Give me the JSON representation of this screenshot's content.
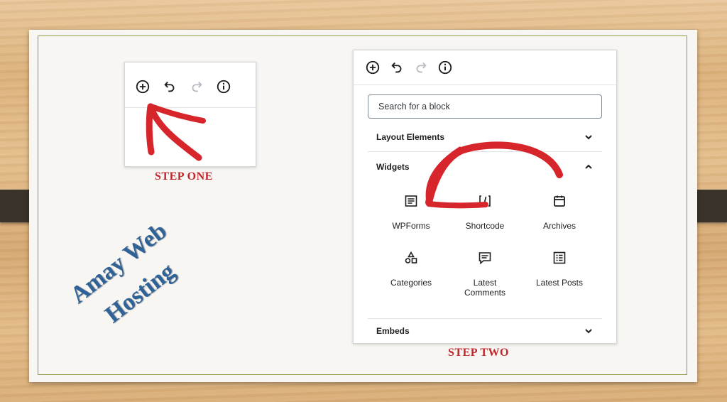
{
  "slide": {
    "step_one": "STEP ONE",
    "step_two": "STEP TWO",
    "watermark_line1": "Amay Web",
    "watermark_line2": "Hosting"
  },
  "toolbar": {
    "icons": [
      "add-block-icon",
      "undo-icon",
      "redo-icon",
      "info-icon"
    ]
  },
  "inserter": {
    "search_placeholder": "Search for a block",
    "sections": {
      "layout": "Layout Elements",
      "widgets": "Widgets",
      "embeds": "Embeds"
    },
    "blocks": [
      {
        "label": "WPForms",
        "icon": "wpforms-icon"
      },
      {
        "label": "Shortcode",
        "icon": "shortcode-icon"
      },
      {
        "label": "Archives",
        "icon": "calendar-icon"
      },
      {
        "label": "Categories",
        "icon": "shapes-icon"
      },
      {
        "label": "Latest\nComments",
        "icon": "comment-icon"
      },
      {
        "label": "Latest Posts",
        "icon": "list-icon"
      }
    ]
  },
  "colors": {
    "accent_red": "#c0262c",
    "watermark_blue": "#2f6296",
    "frame_green": "#8a9a3c",
    "annotation_red": "#d7262b"
  }
}
